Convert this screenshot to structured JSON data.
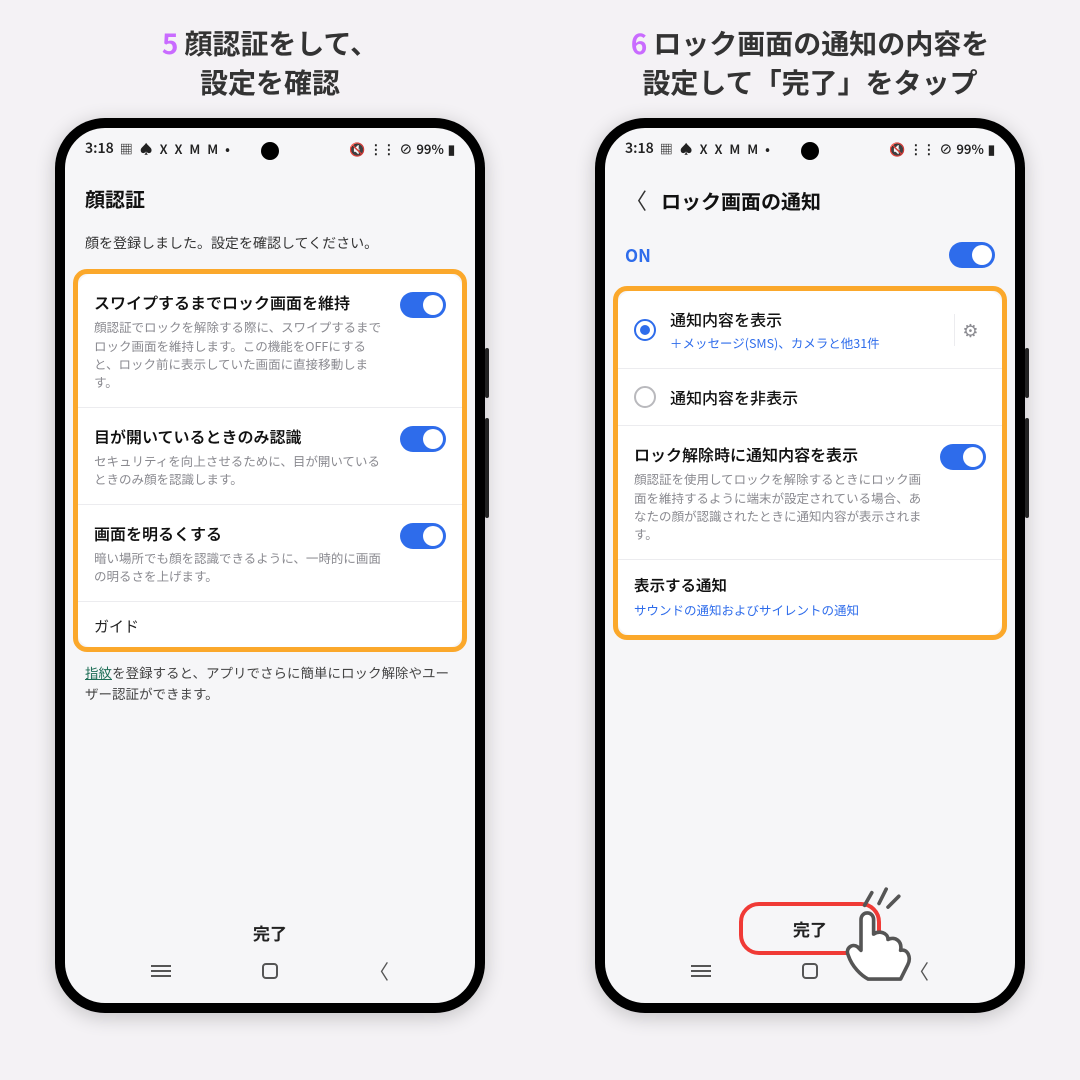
{
  "captions": {
    "step5_num": "5",
    "step5": "顔認証をして、\n設定を確認",
    "step6_num": "6",
    "step6": "ロック画面の通知の内容を\n設定して「完了」をタップ"
  },
  "status": {
    "time": "3:18",
    "icons_left": "▦ ♠ X X M M •",
    "mute": "🔇",
    "wifi": "⋮⋮",
    "nodata": "⊘",
    "battery_pct": "99%",
    "battery": "▮"
  },
  "phone1": {
    "title": "顔認証",
    "registered_note": "顔を登録しました。設定を確認してください。",
    "settings": [
      {
        "title": "スワイプするまでロック画面を維持",
        "desc": "顔認証でロックを解除する際に、スワイプするまでロック画面を維持します。この機能をOFFにすると、ロック前に表示していた画面に直接移動します。"
      },
      {
        "title": "目が開いているときのみ認識",
        "desc": "セキュリティを向上させるために、目が開いているときのみ顔を認識します。"
      },
      {
        "title": "画面を明るくする",
        "desc": "暗い場所でも顔を認識できるように、一時的に画面の明るさを上げます。"
      }
    ],
    "guide_label": "ガイド",
    "footnote_link": "指紋",
    "footnote_rest": "を登録すると、アプリでさらに簡単にロック解除やユーザー認証ができます。",
    "done": "完了"
  },
  "phone2": {
    "title": "ロック画面の通知",
    "on_label": "ON",
    "radio": [
      {
        "title": "通知内容を表示",
        "sub": "＋メッセージ(SMS)、カメラと他31件"
      },
      {
        "title": "通知内容を非表示"
      }
    ],
    "unlock_show": {
      "title": "ロック解除時に通知内容を表示",
      "desc": "顔認証を使用してロックを解除するときにロック画面を維持するように端末が設定されている場合、あなたの顔が認識されたときに通知内容が表示されます。"
    },
    "show_notif": {
      "title": "表示する通知",
      "sub": "サウンドの通知およびサイレントの通知"
    },
    "done": "完了"
  }
}
